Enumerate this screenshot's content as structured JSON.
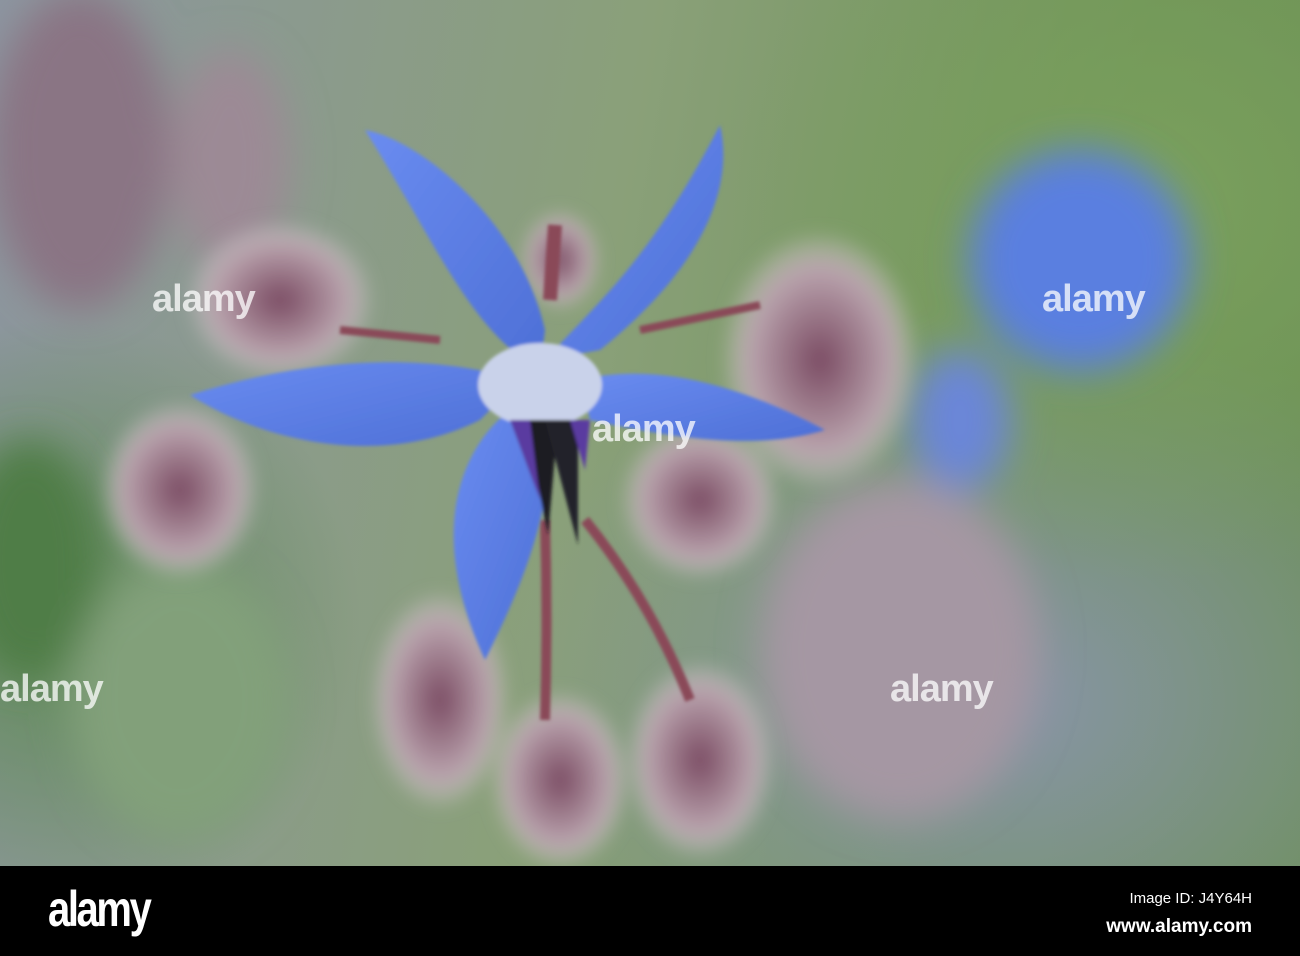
{
  "photo": {
    "subject": "borage flower",
    "watermark": "alamy"
  },
  "footer": {
    "logo": "alamy",
    "image_id": "Image ID: J4Y64H",
    "url": "www.alamy.com"
  },
  "colors": {
    "petal": "#5b7fe2",
    "bud": "#7a4a62",
    "background": "#7aa05d"
  }
}
